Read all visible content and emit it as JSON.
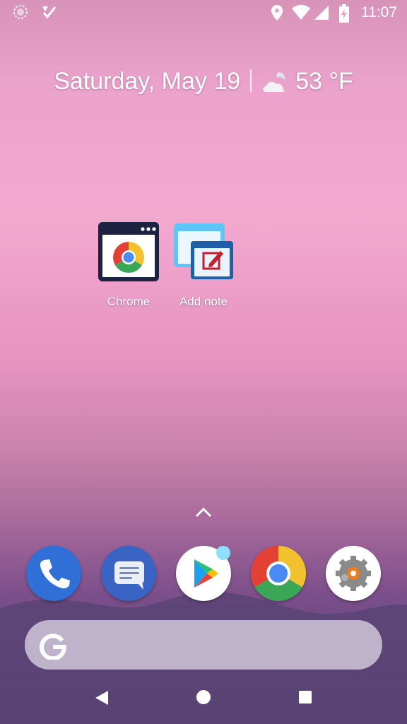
{
  "status_bar": {
    "time": "11:07",
    "left_icons": [
      "sync-icon",
      "notification-check-icon"
    ],
    "right_icons": [
      "location-icon",
      "wifi-icon",
      "cell-signal-icon",
      "battery-charging-icon"
    ]
  },
  "date_widget": {
    "date": "Saturday, May 19",
    "weather_icon": "partly-cloudy-night-icon",
    "temperature": "53 °F"
  },
  "home_apps": [
    {
      "label": "Chrome",
      "icon": "chrome-shortcut-icon"
    },
    {
      "label": "Add note",
      "icon": "add-note-icon"
    }
  ],
  "dock": {
    "apps": [
      "phone-icon",
      "messages-icon",
      "play-store-icon",
      "chrome-icon",
      "settings-icon"
    ],
    "play_store_notification": true
  },
  "search_bar": {
    "icon": "google-g-icon"
  },
  "nav_bar": {
    "buttons": [
      "back-icon",
      "home-icon",
      "recents-icon"
    ]
  },
  "colors": {
    "phone_blue": "#2f6fd6",
    "messages_blue": "#3964c4",
    "badge": "#8ee0ff"
  }
}
